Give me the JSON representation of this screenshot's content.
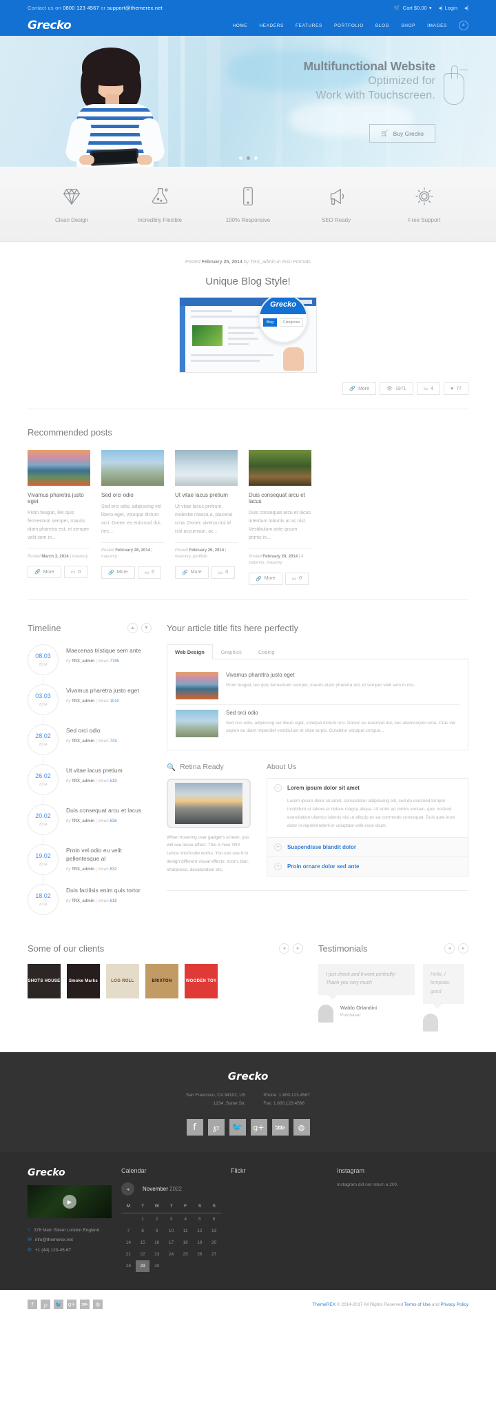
{
  "topbar": {
    "contact_prefix": "Contact us on ",
    "phone": "0800 123 4567",
    "contact_mid": " or ",
    "email": "support@themerex.net",
    "cart_label": "Cart $0.00",
    "cart_caret": "▾",
    "login_label": "Login",
    "cart_icon": "shopping-cart-icon",
    "login_icon": "login-icon",
    "lang_icon": "language-icon"
  },
  "header": {
    "logo": "Grecko",
    "nav": [
      "HOME",
      "HEADERS",
      "FEATURES",
      "PORTFOLIO",
      "BLOG",
      "SHOP",
      "IMAGES"
    ],
    "search_icon": "search-icon"
  },
  "hero": {
    "title": "Multifunctional Website",
    "line2": "Optimized for",
    "line3": "Work with Touchscreen.",
    "buy_label": "Buy Grecko",
    "cart_icon": "shopping-cart-icon",
    "dots": 3,
    "active_dot": 1
  },
  "features": [
    {
      "icon": "diamond-icon",
      "label": "Clean Design"
    },
    {
      "icon": "flask-icon",
      "label": "Incredibly Flexible"
    },
    {
      "icon": "mobile-icon",
      "label": "100% Responsive"
    },
    {
      "icon": "megaphone-icon",
      "label": "SEO Ready"
    },
    {
      "icon": "gear-icon",
      "label": "Free Support"
    }
  ],
  "post": {
    "meta_posted": "Posted ",
    "meta_date": "February 25, 2014",
    "meta_by": " by ",
    "meta_author": "TRX_admin",
    "meta_in": " in ",
    "meta_cat": "Post Formats",
    "title": "Unique Blog Style!",
    "lens_brand": "Grecko",
    "lens_tabs": [
      "Blog",
      "Categories"
    ],
    "lens_active_tab": "Blog",
    "buttons": [
      {
        "icon": "link-icon",
        "label": "More"
      },
      {
        "icon": "eye-icon",
        "label": "1971"
      },
      {
        "icon": "comment-icon",
        "label": "4"
      },
      {
        "icon": "heart-icon",
        "label": "77"
      }
    ]
  },
  "recommended": {
    "title": "Recommended posts",
    "posts": [
      {
        "title": "Vivamus pharetra justo eget",
        "excerpt": "Proin feugiat, leo quis fermentum semper, mauris diam pharetra est, et semper velit sem in...",
        "posted": "Posted ",
        "date": "March 3, 2014",
        "cats": " |  masonry",
        "more": "More",
        "comments": "0"
      },
      {
        "title": "Sed orci odio",
        "excerpt": "Sed orci odio, adipiscing vel libero eget, volutpat dictum orci. Donec eu euismod dui, nec...",
        "posted": "Posted ",
        "date": "February 28, 2014",
        "cats": " |  masonry",
        "more": "More",
        "comments": "0"
      },
      {
        "title": "Ut vitae lacus pretium",
        "excerpt": "Ut vitae lacus pretium, molestie massa a, placerat urna. Donec viverra nisl id nisl accumsan, ac...",
        "posted": "Posted ",
        "date": "February 26, 2014",
        "cats": " |  masonry, portfolio",
        "more": "More",
        "comments": "0"
      },
      {
        "title": "Duis consequat arcu et lacus",
        "excerpt": "Duis consequat arcu et lacus interdum lobortis at ac nisl. Vestibulum ante ipsum primis in...",
        "posted": "Posted ",
        "date": "February 20, 2014",
        "cats": " |  4 columns, masonry",
        "more": "More",
        "comments": "0"
      }
    ]
  },
  "timeline": {
    "title": "Timeline",
    "up_icon": "arrow-up-icon",
    "down_icon": "arrow-down-icon",
    "items": [
      {
        "day": "08.03",
        "year": "2014",
        "title": "Maecenas tristique sem ante",
        "by": "by ",
        "author": "TRX_admin",
        "sep": " | ",
        "views_label": "Views ",
        "views": "7785"
      },
      {
        "day": "03.03",
        "year": "2014",
        "title": "Vivamus pharetra justo eget",
        "by": "by ",
        "author": "TRX_admin",
        "sep": " | ",
        "views_label": "Views ",
        "views": "1010"
      },
      {
        "day": "28.02",
        "year": "2014",
        "title": "Sed orci odio",
        "by": "by ",
        "author": "TRX_admin",
        "sep": " | ",
        "views_label": "Views ",
        "views": "743"
      },
      {
        "day": "26.02",
        "year": "2014",
        "title": "Ut vitae lacus pretium",
        "by": "by ",
        "author": "TRX_admin",
        "sep": " | ",
        "views_label": "Views ",
        "views": "519"
      },
      {
        "day": "20.02",
        "year": "2014",
        "title": "Duis consequat arcu et lacus",
        "by": "by ",
        "author": "TRX_admin",
        "sep": " | ",
        "views_label": "Views ",
        "views": "636"
      },
      {
        "day": "19.02",
        "year": "2014",
        "title": "Proin vel odio eu velit pellentesque al",
        "by": "by ",
        "author": "TRX_admin",
        "sep": " | ",
        "views_label": "Views ",
        "views": "832"
      },
      {
        "day": "18.02",
        "year": "2014",
        "title": "Duis facilisis enim quis tortor",
        "by": "by ",
        "author": "TRX_admin",
        "sep": " | ",
        "views_label": "Views ",
        "views": "618"
      }
    ]
  },
  "article": {
    "title": "Your article title fits here perfectly",
    "tabs": [
      "Web Design",
      "Graphics",
      "Coding"
    ],
    "active_tab": "Web Design",
    "rows": [
      {
        "title": "Vivamus pharetra justo eget",
        "text": "Proin feugiat, leo quis fermentum semper, mauris diam pharetra est, et semper velit sem in nisi."
      },
      {
        "title": "Sed orci odio",
        "text": "Sed orci odio, adipiscing vel libero eget, volutpat dictum orci. Donec eu euismod dui, nec ullamcorper urna. Cras vel sapien eu diam imperdiet vestibulum et vitae turpis. Curabitur volutpat congue..."
      }
    ]
  },
  "retina": {
    "title": "Retina Ready",
    "icon": "magnifier-icon",
    "caption": "When hovering over gadget's screen, you will see lense effect. This is how  TRX Lence shortcode works. You can use it to design different visual effects: zoom, blur, sharpness, desaturation etc."
  },
  "about": {
    "title": "About Us",
    "items": [
      {
        "label": "Lorem ipsum dolor sit amet",
        "state": "open",
        "sign": "–",
        "body": "Lorem ipsum dolor sit amet, consectetur adipisicing elit, sed do eiusmod tempor incididunt ut labore et dolore magna aliqua. Ut enim ad minim veniam, quis nostrud exercitation ullamco laboris nisi ut aliquip ex ea commodo consequat. Duis aute irure dolor in reprehenderit in voluptate velit esse cilum."
      },
      {
        "label": "Suspendisse blandit dolor",
        "state": "closed",
        "sign": "+",
        "body": ""
      },
      {
        "label": "Proin ornare dolor sed ante",
        "state": "closed",
        "sign": "+",
        "body": ""
      }
    ]
  },
  "clients": {
    "title": "Some of our clients",
    "prev_icon": "arrow-left-icon",
    "next_icon": "arrow-right-icon",
    "logos": [
      {
        "name": "SHOTS HOUSE",
        "color": "#2c2725"
      },
      {
        "name": "Smoke Marks",
        "color": "#261d1d"
      },
      {
        "name": "LOG ROLL",
        "color": "#e4dcc8"
      },
      {
        "name": "BRIXTON",
        "color": "#c29a63"
      },
      {
        "name": "WOODEN TOY",
        "color": "#e03a37"
      }
    ]
  },
  "testimonials": {
    "title": "Testimonials",
    "prev_icon": "arrow-left-icon",
    "next_icon": "arrow-right-icon",
    "items": [
      {
        "quote": "I just check and it work perfectly! Thank you very much",
        "name": "Waldo Orlandini",
        "role": "Purchaser"
      },
      {
        "quote": "Hello, I template, good",
        "name": "",
        "role": ""
      }
    ]
  },
  "footer_top": {
    "logo": "Grecko",
    "addr_line1": "San Francisco, CA 94102, US",
    "addr_line2": "1234, Some Str.",
    "phone": "Phone: 1.800.123.4567",
    "fax": "Fax: 1.800.123.4566",
    "socials": [
      "facebook-icon",
      "pinterest-icon",
      "twitter-icon",
      "googleplus-icon",
      "rss-icon",
      "dribbble-icon"
    ],
    "social_glyphs": [
      "f",
      "𝓟",
      "🐦",
      "g+",
      "⋙",
      "◍"
    ]
  },
  "footer_widgets": {
    "logo": "Grecko",
    "video_play_icon": "play-icon",
    "address": "378 Main Street London England",
    "email": "info@themerex.net",
    "phone": "+1 (44) 123-45-67",
    "address_icon": "home-icon",
    "email_icon": "mail-icon",
    "phone_icon": "phone-icon",
    "calendar": {
      "title": "Calendar",
      "prev_icon": "chevron-left-icon",
      "month": "November",
      "year": "2022",
      "weekdays": [
        "M",
        "T",
        "W",
        "T",
        "F",
        "S",
        "S"
      ],
      "weeks": [
        [
          "",
          "1",
          "2",
          "3",
          "4",
          "5",
          "6"
        ],
        [
          "7",
          "8",
          "9",
          "10",
          "11",
          "12",
          "13"
        ],
        [
          "14",
          "15",
          "16",
          "17",
          "18",
          "19",
          "20"
        ],
        [
          "21",
          "22",
          "23",
          "24",
          "25",
          "26",
          "27"
        ],
        [
          "28",
          "29",
          "30",
          "",
          "",
          "",
          ""
        ]
      ],
      "today": "29"
    },
    "flickr": {
      "title": "Flickr"
    },
    "instagram": {
      "title": "Instagram",
      "note": "Instagram did not return a 200."
    }
  },
  "footer_bottom": {
    "socials": [
      "facebook-icon",
      "pinterest-icon",
      "twitter-icon",
      "googleplus-icon",
      "rss-icon",
      "dribbble-icon"
    ],
    "social_glyphs": [
      "f",
      "𝓟",
      "🐦",
      "g+",
      "⋙",
      "◍"
    ],
    "brand": "ThemeREX",
    "copy": " © 2014-2017 All Rights Reserved ",
    "terms": "Terms of Use",
    "and": " and ",
    "privacy": "Privacy Policy"
  },
  "colors": {
    "brand_blue": "#1271d3",
    "link_blue": "#2e7fd4",
    "dark": "#333333",
    "dark2": "#2e2e2e"
  }
}
